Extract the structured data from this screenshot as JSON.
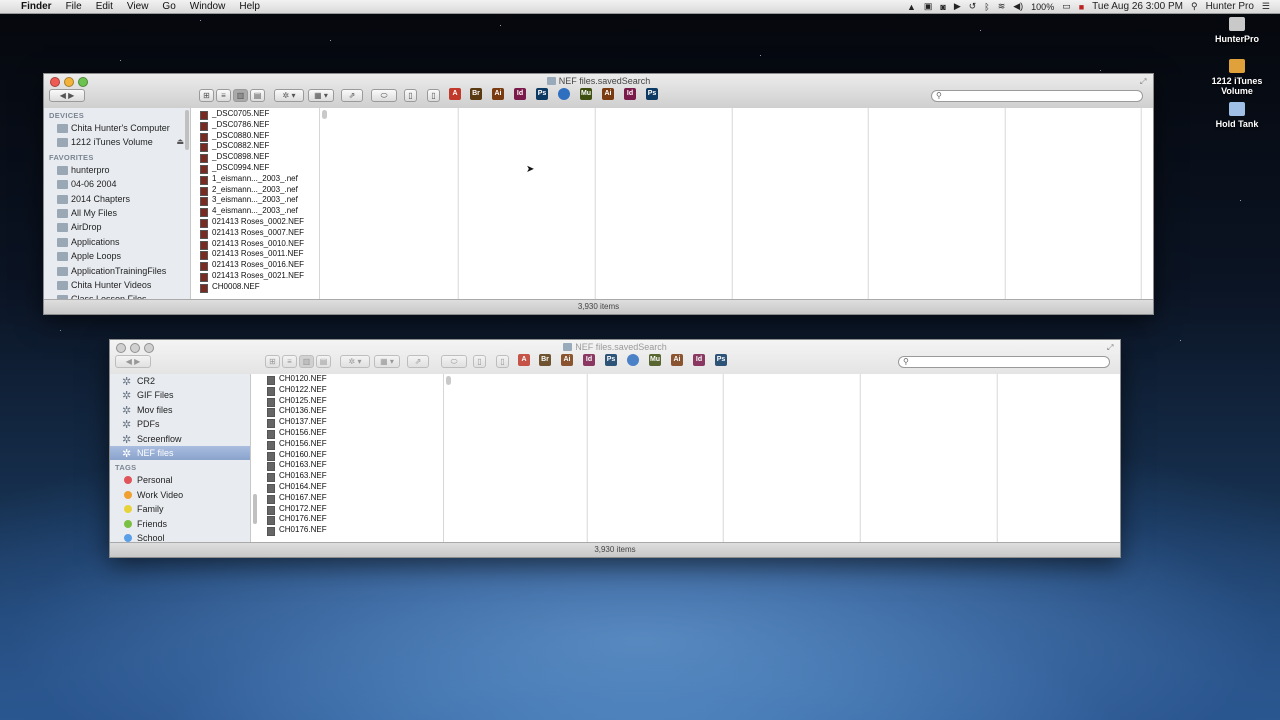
{
  "menubar": {
    "apple": "",
    "app": "Finder",
    "items": [
      "File",
      "Edit",
      "View",
      "Go",
      "Window",
      "Help"
    ],
    "battery": "100%",
    "clock": "Tue Aug 26  3:00 PM",
    "user": "Hunter Pro"
  },
  "desktop": [
    {
      "label": "HunterPro",
      "icon": "hard-drive-icon",
      "color": "#c9c9c9"
    },
    {
      "label": "1212 iTunes Volume",
      "icon": "external-drive-icon",
      "color": "#e0a13a"
    },
    {
      "label": "Hold Tank",
      "icon": "folder-icon",
      "color": "#9fbfe6"
    }
  ],
  "window1": {
    "title": "NEF files.savedSearch",
    "status": "3,930 items",
    "sidebar": {
      "devices_header": "DEVICES",
      "devices": [
        "Chita Hunter's Computer",
        "1212 iTunes Volume"
      ],
      "favorites_header": "FAVORITES",
      "favorites": [
        "hunterpro",
        "04-06 2004",
        "2014 Chapters",
        "All My Files",
        "AirDrop",
        "Applications",
        "Apple Loops",
        "ApplicationTrainingFiles",
        "Chita Hunter Videos",
        "Class Lesson Files"
      ]
    },
    "files": [
      "_DSC0705.NEF",
      "_DSC0786.NEF",
      "_DSC0880.NEF",
      "_DSC0882.NEF",
      "_DSC0898.NEF",
      "_DSC0994.NEF",
      "1_eismann..._2003_.nef",
      "2_eismann..._2003_.nef",
      "3_eismann..._2003_.nef",
      "4_eismann..._2003_.nef",
      "021413 Roses_0002.NEF",
      "021413 Roses_0007.NEF",
      "021413 Roses_0010.NEF",
      "021413 Roses_0011.NEF",
      "021413 Roses_0016.NEF",
      "021413 Roses_0021.NEF",
      "CH0008.NEF"
    ]
  },
  "window2": {
    "title": "NEF files.savedSearch",
    "status": "3,930 items",
    "sidebar": {
      "saved": [
        "CR2",
        "GIF Files",
        "Mov files",
        "PDFs",
        "Screenflow",
        "NEF files"
      ],
      "selected": "NEF files",
      "tags_header": "TAGS",
      "tags": [
        {
          "label": "Personal",
          "color": "#e0545a"
        },
        {
          "label": "Work Video",
          "color": "#f0a030"
        },
        {
          "label": "Family",
          "color": "#e8d23a"
        },
        {
          "label": "Friends",
          "color": "#7bc043"
        },
        {
          "label": "School",
          "color": "#5aa0e8"
        }
      ]
    },
    "files": [
      "CH0120.NEF",
      "CH0122.NEF",
      "CH0125.NEF",
      "CH0136.NEF",
      "CH0137.NEF",
      "CH0156.NEF",
      "CH0156.NEF",
      "CH0160.NEF",
      "CH0163.NEF",
      "CH0163.NEF",
      "CH0164.NEF",
      "CH0167.NEF",
      "CH0172.NEF",
      "CH0176.NEF",
      "CH0176.NEF"
    ]
  },
  "toolbar_apps": [
    {
      "label": "Br",
      "color": "#5a3a12"
    },
    {
      "label": "Ai",
      "color": "#7a3b10"
    },
    {
      "label": "Id",
      "color": "#7a1a4a"
    },
    {
      "label": "Ps",
      "color": "#0d3a63"
    },
    {
      "label": "",
      "color": "#2f6fc0"
    },
    {
      "label": "Mu",
      "color": "#3f4f10"
    },
    {
      "label": "Ai",
      "color": "#7a3b10"
    },
    {
      "label": "Id",
      "color": "#7a1a4a"
    },
    {
      "label": "Ps",
      "color": "#0d3a63"
    }
  ]
}
